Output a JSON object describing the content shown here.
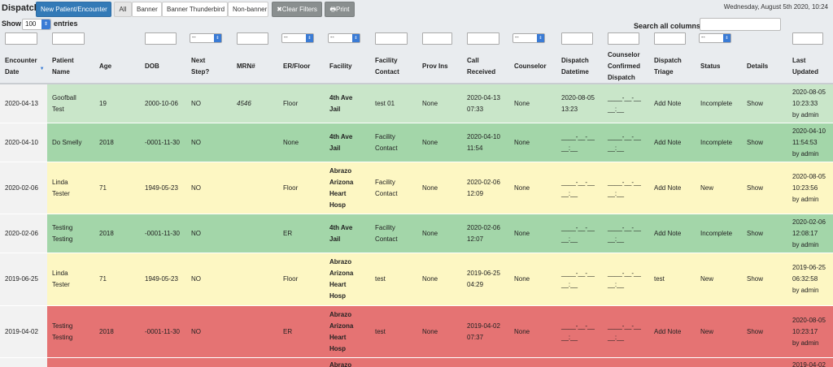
{
  "header": {
    "title": "Dispatch",
    "buttons": [
      "New Patient/Encounter",
      "All",
      "Banner",
      "Banner Thunderbird",
      "Non-banner",
      "Clear Filters",
      "Print"
    ],
    "date": "Wednesday, August 5th 2020, 10:24"
  },
  "controls": {
    "show_label": "Show",
    "entries_value": "100",
    "entries_label": "entries",
    "search_label": "Search all columns"
  },
  "filters": {
    "select_placeholder": "--"
  },
  "columns": [
    [
      "Encounter",
      "Date"
    ],
    [
      "Patient",
      "Name"
    ],
    [
      "Age"
    ],
    [
      "DOB"
    ],
    [
      "Next",
      "Step?"
    ],
    [
      "MRN#"
    ],
    [
      "ER/Floor"
    ],
    [
      "Facility"
    ],
    [
      "Facility",
      "Contact"
    ],
    [
      "Prov Ins"
    ],
    [
      "Call",
      "Received"
    ],
    [
      "Counselor"
    ],
    [
      "Dispatch",
      "Datetime"
    ],
    [
      "Counselor",
      "Confirmed",
      "Dispatch"
    ],
    [
      "Dispatch",
      "Triage"
    ],
    [
      "Status"
    ],
    [
      "Details"
    ],
    [
      "Last",
      "Updated"
    ]
  ],
  "colors": {
    "light_green": "#c9e6c9",
    "green": "#a3d6a9",
    "yellow": "#fdf7c3",
    "red": "#e57373"
  },
  "rows": [
    {
      "color": "light_green",
      "cells": [
        [
          "2020-04-13"
        ],
        [
          "Goofball",
          "Test"
        ],
        [
          "19"
        ],
        [
          "2000-10-06"
        ],
        [
          "NO"
        ],
        [
          "4546"
        ],
        [
          "Floor"
        ],
        [
          "4th Ave",
          "Jail"
        ],
        [
          "test 01"
        ],
        [
          "None"
        ],
        [
          "2020-04-13",
          "07:33"
        ],
        [
          "None"
        ],
        [
          "2020-08-05",
          "13:23"
        ],
        [
          "____-__-__",
          "__:__"
        ],
        [
          "Add Note"
        ],
        [
          "Incomplete"
        ],
        [
          "Show"
        ],
        [
          "2020-08-05",
          "10:23:33",
          "by admin"
        ]
      ]
    },
    {
      "color": "green",
      "cells": [
        [
          "2020-04-10"
        ],
        [
          "Do Smelly"
        ],
        [
          "2018"
        ],
        [
          "-0001-11-30"
        ],
        [
          "NO"
        ],
        [
          ""
        ],
        [
          "None"
        ],
        [
          "4th Ave",
          "Jail"
        ],
        [
          "Facility",
          "Contact"
        ],
        [
          "None"
        ],
        [
          "2020-04-10",
          "11:54"
        ],
        [
          "None"
        ],
        [
          "____-__-__",
          "__:__"
        ],
        [
          "____-__-__",
          "__:__"
        ],
        [
          "Add Note"
        ],
        [
          "Incomplete"
        ],
        [
          "Show"
        ],
        [
          "2020-04-10",
          "11:54:53",
          "by admin"
        ]
      ]
    },
    {
      "color": "yellow",
      "cells": [
        [
          "2020-02-06"
        ],
        [
          "Linda",
          "Tester"
        ],
        [
          "71"
        ],
        [
          "1949-05-23"
        ],
        [
          "NO"
        ],
        [
          ""
        ],
        [
          "Floor"
        ],
        [
          "Abrazo",
          "Arizona",
          "Heart",
          "Hosp"
        ],
        [
          "Facility",
          "Contact"
        ],
        [
          "None"
        ],
        [
          "2020-02-06",
          "12:09"
        ],
        [
          "None"
        ],
        [
          "____-__-__",
          "__:__"
        ],
        [
          "____-__-__",
          "__:__"
        ],
        [
          "Add Note"
        ],
        [
          "New"
        ],
        [
          "Show"
        ],
        [
          "2020-08-05",
          "10:23:56",
          "by admin"
        ]
      ]
    },
    {
      "color": "green",
      "cells": [
        [
          "2020-02-06"
        ],
        [
          "Testing",
          "Testing"
        ],
        [
          "2018"
        ],
        [
          "-0001-11-30"
        ],
        [
          "NO"
        ],
        [
          ""
        ],
        [
          "ER"
        ],
        [
          "4th Ave",
          "Jail"
        ],
        [
          "Facility",
          "Contact"
        ],
        [
          "None"
        ],
        [
          "2020-02-06",
          "12:07"
        ],
        [
          "None"
        ],
        [
          "____-__-__",
          "__:__"
        ],
        [
          "____-__-__",
          "__:__"
        ],
        [
          "Add Note"
        ],
        [
          "Incomplete"
        ],
        [
          "Show"
        ],
        [
          "2020-02-06",
          "12:08:17",
          "by admin"
        ]
      ]
    },
    {
      "color": "yellow",
      "cells": [
        [
          "2019-06-25"
        ],
        [
          "Linda",
          "Tester"
        ],
        [
          "71"
        ],
        [
          "1949-05-23"
        ],
        [
          "NO"
        ],
        [
          ""
        ],
        [
          "Floor"
        ],
        [
          "Abrazo",
          "Arizona",
          "Heart",
          "Hosp"
        ],
        [
          "test"
        ],
        [
          "None"
        ],
        [
          "2019-06-25",
          "04:29"
        ],
        [
          "None"
        ],
        [
          "____-__-__",
          "__:__"
        ],
        [
          "____-__-__",
          "__:__"
        ],
        [
          "test"
        ],
        [
          "New"
        ],
        [
          "Show"
        ],
        [
          "2019-06-25",
          "06:32:58",
          "by admin"
        ]
      ]
    },
    {
      "color": "red",
      "cells": [
        [
          "2019-04-02"
        ],
        [
          "Testing",
          "Testing"
        ],
        [
          "2018"
        ],
        [
          "-0001-11-30"
        ],
        [
          "NO"
        ],
        [
          ""
        ],
        [
          "ER"
        ],
        [
          "Abrazo",
          "Arizona",
          "Heart",
          "Hosp"
        ],
        [
          "test"
        ],
        [
          "None"
        ],
        [
          "2019-04-02",
          "07:37"
        ],
        [
          "None"
        ],
        [
          "____-__-__",
          "__:__"
        ],
        [
          "____-__-__",
          "__:__"
        ],
        [
          "Add Note"
        ],
        [
          "New"
        ],
        [
          "Show"
        ],
        [
          "2020-08-05",
          "10:23:17",
          "by admin"
        ]
      ]
    },
    {
      "color": "red",
      "cells": [
        [
          ""
        ],
        [
          ""
        ],
        [
          ""
        ],
        [
          ""
        ],
        [
          ""
        ],
        [
          ""
        ],
        [
          ""
        ],
        [
          "Abrazo"
        ],
        [
          ""
        ],
        [
          ""
        ],
        [
          ""
        ],
        [
          ""
        ],
        [
          ""
        ],
        [
          ""
        ],
        [
          ""
        ],
        [
          ""
        ],
        [
          ""
        ],
        [
          "2019-04-02"
        ]
      ]
    }
  ]
}
